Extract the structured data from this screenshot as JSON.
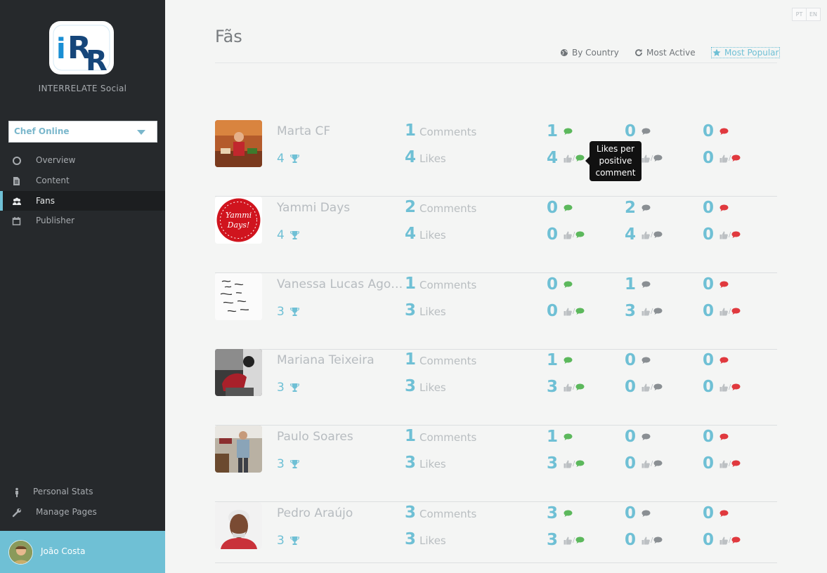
{
  "app": {
    "brand_name": "INTERRELATE Social",
    "logo_text": "iRR",
    "account_select": "Chef Online",
    "accent_color": "#6fc0d5"
  },
  "sidebar": {
    "items": [
      {
        "label": "Overview",
        "icon": "circle-icon"
      },
      {
        "label": "Content",
        "icon": "document-icon"
      },
      {
        "label": "Fans",
        "icon": "users-icon",
        "active": true
      },
      {
        "label": "Publisher",
        "icon": "calendar-icon"
      }
    ],
    "bottom_items": [
      {
        "label": "Personal Stats",
        "icon": "person-icon"
      },
      {
        "label": "Manage Pages",
        "icon": "wrench-icon"
      }
    ],
    "user_name": "João Costa"
  },
  "lang": {
    "pt": "PT",
    "en": "EN"
  },
  "page": {
    "title": "Fãs",
    "sort_tabs": [
      {
        "label": "By Country",
        "icon": "globe-icon"
      },
      {
        "label": "Most Active",
        "icon": "refresh-icon"
      },
      {
        "label": "Most Popular",
        "icon": "star-icon",
        "active": true
      }
    ],
    "comments_label": "Comments",
    "likes_label": "Likes",
    "tooltip": "Likes per positive comment"
  },
  "fans": [
    {
      "name": "Marta CF",
      "rank": "4",
      "comments": "1",
      "likes": "4",
      "positive_comments": "1",
      "positive_likes": "4",
      "neutral_comments": "0",
      "neutral_likes": "0",
      "negative_comments": "0",
      "negative_likes": "0"
    },
    {
      "name": "Yammi Days",
      "rank": "4",
      "comments": "2",
      "likes": "4",
      "positive_comments": "0",
      "positive_likes": "0",
      "neutral_comments": "2",
      "neutral_likes": "4",
      "negative_comments": "0",
      "negative_likes": "0"
    },
    {
      "name": "Vanessa Lucas Agostinho",
      "rank": "3",
      "comments": "1",
      "likes": "3",
      "positive_comments": "0",
      "positive_likes": "0",
      "neutral_comments": "1",
      "neutral_likes": "3",
      "negative_comments": "0",
      "negative_likes": "0"
    },
    {
      "name": "Mariana Teixeira",
      "rank": "3",
      "comments": "1",
      "likes": "3",
      "positive_comments": "1",
      "positive_likes": "3",
      "neutral_comments": "0",
      "neutral_likes": "0",
      "negative_comments": "0",
      "negative_likes": "0"
    },
    {
      "name": "Paulo Soares",
      "rank": "3",
      "comments": "1",
      "likes": "3",
      "positive_comments": "1",
      "positive_likes": "3",
      "neutral_comments": "0",
      "neutral_likes": "0",
      "negative_comments": "0",
      "negative_likes": "0"
    },
    {
      "name": "Pedro Araújo",
      "rank": "3",
      "comments": "3",
      "likes": "3",
      "positive_comments": "3",
      "positive_likes": "3",
      "neutral_comments": "0",
      "neutral_likes": "0",
      "negative_comments": "0",
      "negative_likes": "0"
    }
  ],
  "sentiment_colors": {
    "positive": "#5cb85c",
    "neutral": "#8a8f93",
    "negative": "#e0393e"
  }
}
